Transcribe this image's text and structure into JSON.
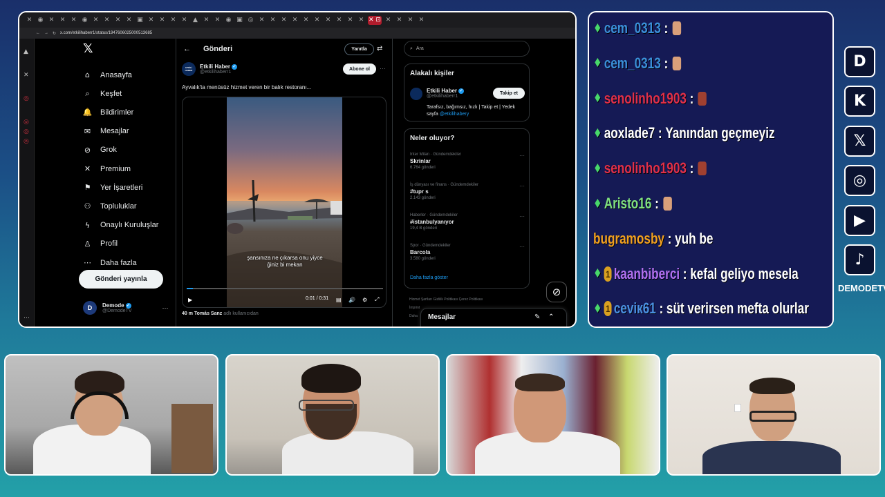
{
  "browser": {
    "tab_glyphs": [
      "✕",
      "◉",
      "✕",
      "✕",
      "✕",
      "◉",
      "✕",
      "✕",
      "✕",
      "✕",
      "▣",
      "✕",
      "✕",
      "✕",
      "✕",
      "▲",
      "✕",
      "✕",
      "◉",
      "▣",
      "◎",
      "✕",
      "✕",
      "✕",
      "✕",
      "✕",
      "✕",
      "✕",
      "✕",
      "✕",
      "✕",
      "✕",
      "✕",
      "✕",
      "✕"
    ],
    "active_tab": "✕ ⊡",
    "url": "x.com/etkilihaberr1/status/1947606025000513685"
  },
  "sidebar": {
    "logo": "𝕏",
    "items": [
      {
        "label": "Anasayfa",
        "icon": "⌂"
      },
      {
        "label": "Keşfet",
        "icon": "⌕"
      },
      {
        "label": "Bildirimler",
        "icon": "🔔"
      },
      {
        "label": "Mesajlar",
        "icon": "✉"
      },
      {
        "label": "Grok",
        "icon": "⊘"
      },
      {
        "label": "Premium",
        "icon": "✕"
      },
      {
        "label": "Yer İşaretleri",
        "icon": "⚑"
      },
      {
        "label": "Topluluklar",
        "icon": "⚇"
      },
      {
        "label": "Onaylı Kuruluşlar",
        "icon": "ϟ"
      },
      {
        "label": "Profil",
        "icon": "♙"
      },
      {
        "label": "Daha fazla",
        "icon": "⋯"
      }
    ],
    "post_button": "Gönderi yayınla",
    "account": {
      "name": "Demode",
      "handle": "@DemodeTV",
      "avatar": "D"
    }
  },
  "center": {
    "back": "←",
    "title": "Gönderi",
    "reply_button": "Yanıtla",
    "author": {
      "name": "Etkili Haber",
      "handle": "@etkilihaberr1",
      "avatar": "ETKİLİ HABER"
    },
    "subscribe_button": "Abone ol",
    "more": "···",
    "tweet_text": "Ayvalık'ta menüsüz hizmet veren bir balık restoranı...",
    "video": {
      "subtitle_line1": "şansınıza ne çıkarsa onu yiyce",
      "subtitle_line2": "ğiniz bi mekan",
      "time": "0:01 / 0:31",
      "progress": 0.03
    },
    "views": "40 m",
    "views_source_name": "Tomás Sanz",
    "views_suffix": "adlı kullanıcıdan"
  },
  "right": {
    "search_placeholder": "Ara",
    "related": {
      "title": "Alakalı kişiler",
      "name": "Etkili Haber",
      "handle": "@etkilihaberr1",
      "follow_button": "Takip et",
      "bio": "Tarafsız, bağımsız, hızlı | Takip et | Yedek sayfa",
      "bio_link": "@etkilihabery"
    },
    "trends": {
      "title": "Neler oluyor?",
      "items": [
        {
          "category": "Inter Milan · Gündemdekiler",
          "title": "Skrinlar",
          "count": "6.764 gönderi"
        },
        {
          "category": "İş dünyası ve finans · Gündemdekiler",
          "title": "#tupr s",
          "count": "2.143 gönderi"
        },
        {
          "category": "Haberler · Gündemdekiler",
          "title": "#istanbulyanıyor",
          "count": "19,4 B gönderi"
        },
        {
          "category": "Spor · Gündemdekiler",
          "title": "Barcola",
          "count": "3.580 gönderi"
        }
      ],
      "show_more": "Daha fazla göster"
    },
    "footer": [
      "Hizmet Şartları   Gizlilik Politikası   Çerez Politikası",
      "İmprint",
      "Daha"
    ],
    "messages": "Mesajlar"
  },
  "chat": [
    {
      "user": "cem_0313",
      "color": "#3a8fd8",
      "text": "",
      "emote": "hand"
    },
    {
      "user": "cem_0313",
      "color": "#3a8fd8",
      "text": "",
      "emote": "hand"
    },
    {
      "user": "senolinho1903",
      "color": "#e0304a",
      "text": "",
      "emote": "red"
    },
    {
      "user": "aoxlade7",
      "color": "#ffffff",
      "text": "Yanından geçmeyiz",
      "emote": ""
    },
    {
      "user": "senolinho1903",
      "color": "#e0304a",
      "text": "",
      "emote": "red"
    },
    {
      "user": "Aristo16",
      "color": "#80e080",
      "text": "",
      "emote": "hand"
    },
    {
      "user": "bugramosby",
      "color": "#f0a020",
      "text": "yuh be",
      "emote": "",
      "nogem": true
    },
    {
      "user": "kaanbiberci",
      "color": "#b070f0",
      "text": "kefal geliyo mesela",
      "emote": "",
      "badge": "1"
    },
    {
      "user": "ceviк61",
      "color": "#4a90e0",
      "text": "süt verirsen mefta olurlar",
      "emote": "",
      "badge": "1"
    }
  ],
  "socials": {
    "icons": [
      "D",
      "K",
      "𝕏",
      "◎",
      "▶",
      "♪"
    ],
    "channel": "DEMODETV"
  }
}
